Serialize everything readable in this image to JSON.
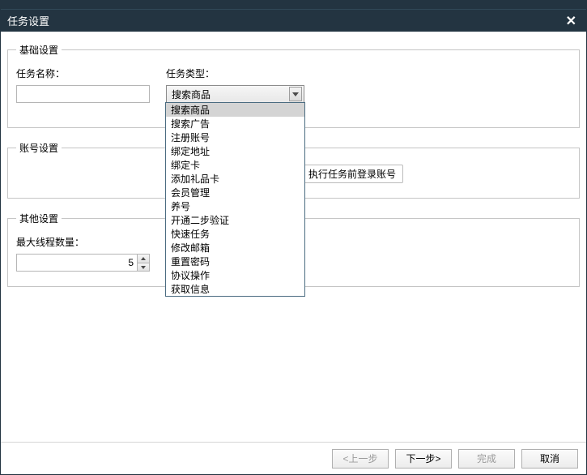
{
  "window": {
    "title": "任务设置",
    "close_icon": "✕"
  },
  "basic": {
    "legend": "基础设置",
    "task_name_label": "任务名称：",
    "task_name_value": "",
    "task_type_label": "任务类型：",
    "task_type_selected": "搜索商品",
    "task_type_options": [
      "搜索商品",
      "搜索广告",
      "注册账号",
      "绑定地址",
      "绑定卡",
      "添加礼品卡",
      "会员管理",
      "养号",
      "开通二步验证",
      "快速任务",
      "修改邮箱",
      "重置密码",
      "协议操作",
      "获取信息"
    ]
  },
  "account": {
    "legend": "账号设置",
    "radio_login_label": "执行任务前登录账号"
  },
  "other": {
    "legend": "其他设置",
    "max_threads_label": "最大线程数量：",
    "max_threads_value": "5"
  },
  "footer": {
    "prev": "<上一步",
    "next": "下一步>",
    "finish": "完成",
    "cancel": "取消"
  }
}
